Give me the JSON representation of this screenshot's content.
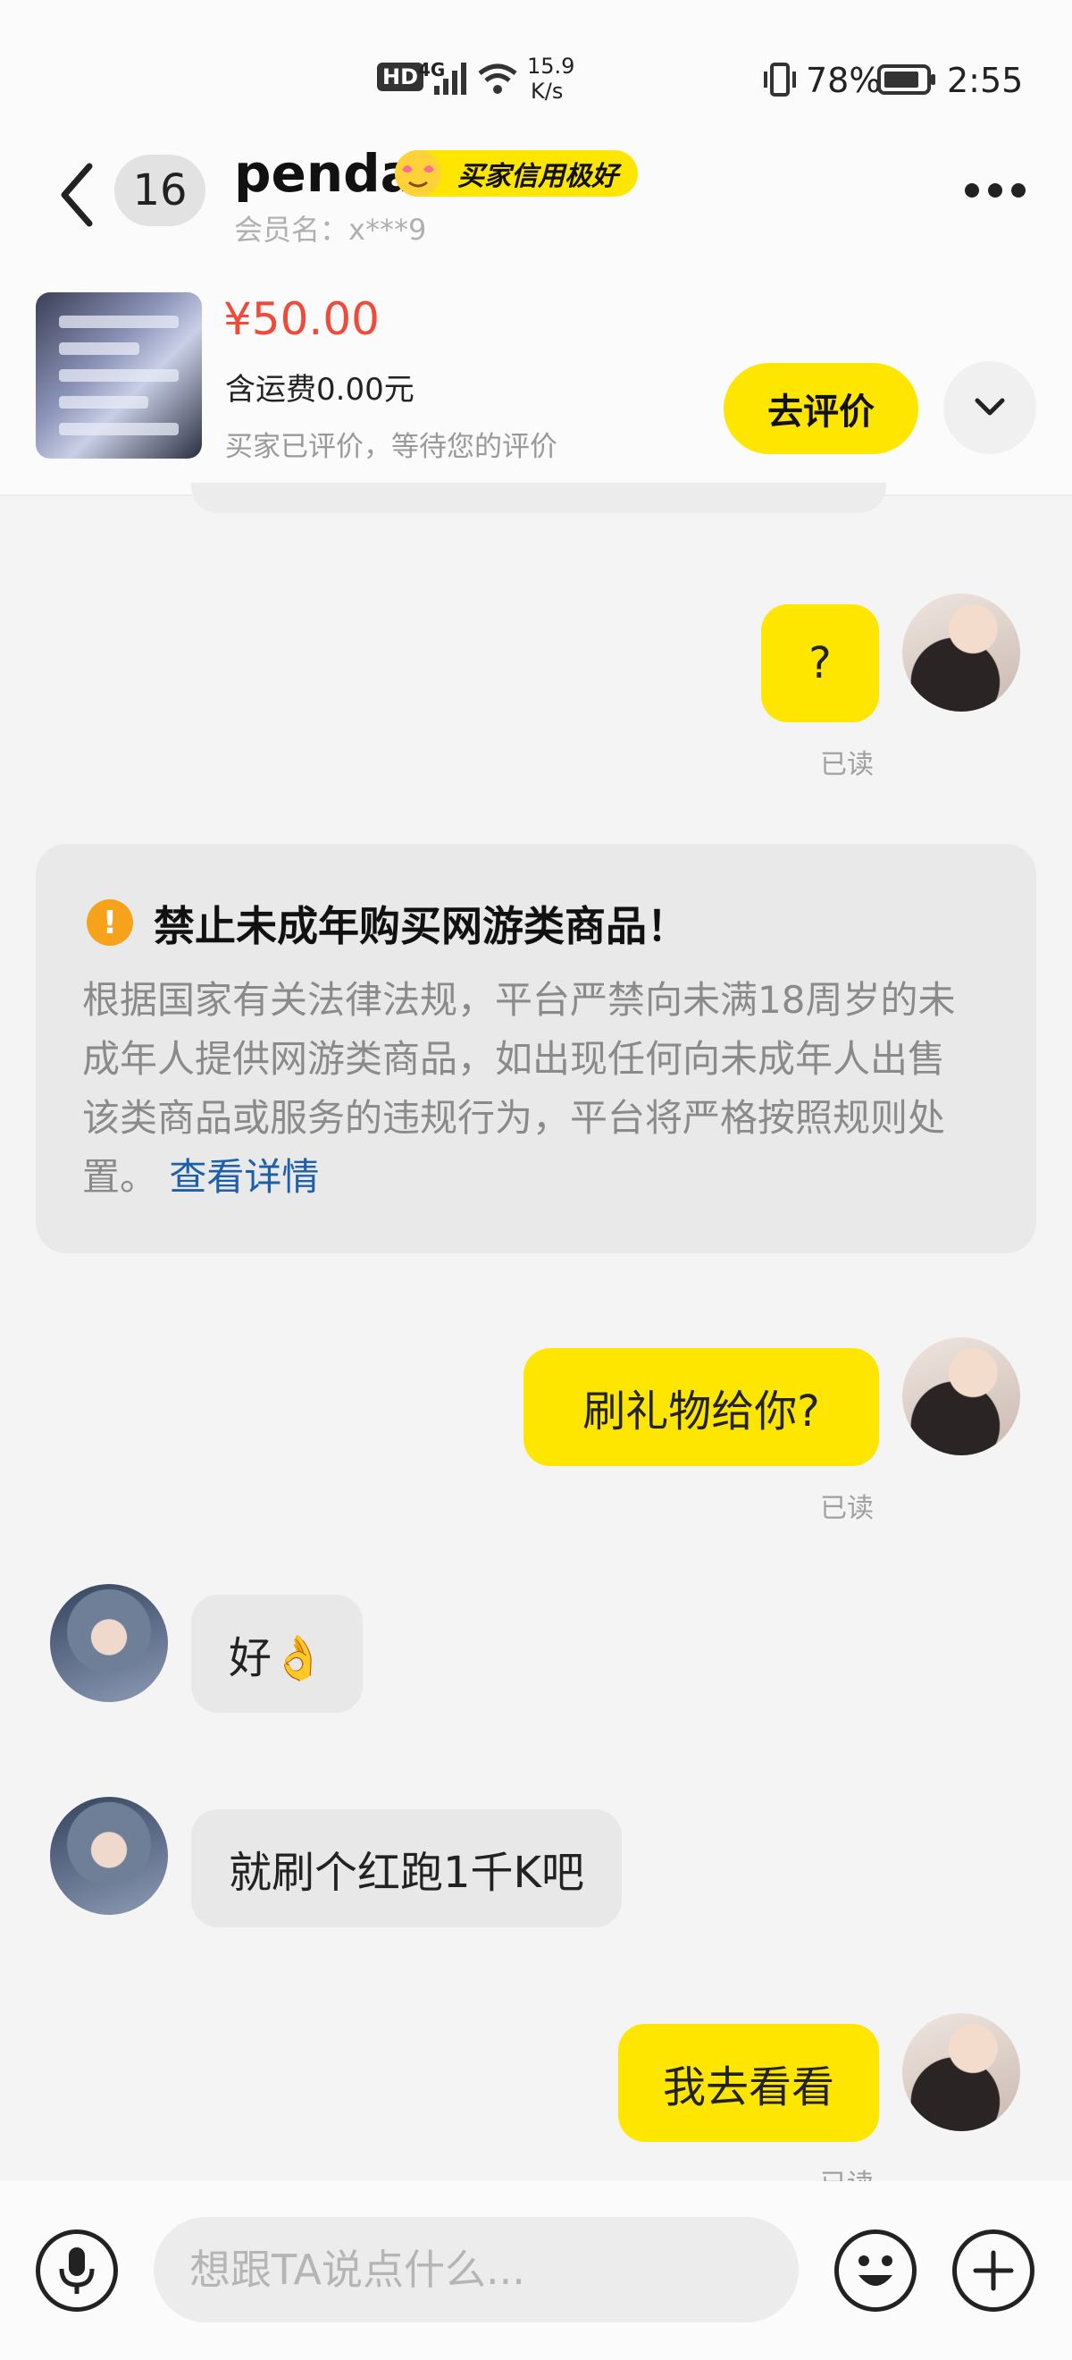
{
  "status_bar": {
    "hd": "HD",
    "network": "4G",
    "speed_value": "15.9",
    "speed_unit": "K/s",
    "battery": "78%",
    "time": "2:55"
  },
  "header": {
    "unread_count": "16",
    "contact_name": "penda",
    "credit_badge": "买家信用极好",
    "member_name": "会员名：x***9"
  },
  "order": {
    "price": "¥50.00",
    "shipping": "含运费0.00元",
    "status": "买家已评价，等待您的评价",
    "review_button": "去评价"
  },
  "messages": [
    {
      "from": "me",
      "text": "?",
      "status": "已读"
    },
    {
      "from": "me",
      "text": "刷礼物给你?",
      "status": "已读"
    },
    {
      "from": "other",
      "text": "好👌"
    },
    {
      "from": "other",
      "text": "就刷个红跑1千K吧"
    },
    {
      "from": "me",
      "text": "我去看看",
      "status": "已读"
    }
  ],
  "notice": {
    "title": "禁止未成年购买网游类商品！",
    "body": "根据国家有关法律法规，平台严禁向未满18周岁的未成年人提供网游类商品，如出现任何向未成年人出售该类商品或服务的违规行为，平台将严格按照规则处置。",
    "link": "查看详情"
  },
  "input": {
    "placeholder": "想跟TA说点什么..."
  },
  "colors": {
    "accent": "#ffe600",
    "price": "#f04a3a",
    "link": "#1d5fa8",
    "warning": "#f7a21b"
  },
  "icons": [
    "back-chevron-icon",
    "more-icon",
    "chevron-down-icon",
    "microphone-icon",
    "emoji-icon",
    "plus-icon",
    "warning-icon",
    "signal-icon",
    "wifi-icon",
    "battery-icon",
    "vibrate-icon"
  ]
}
